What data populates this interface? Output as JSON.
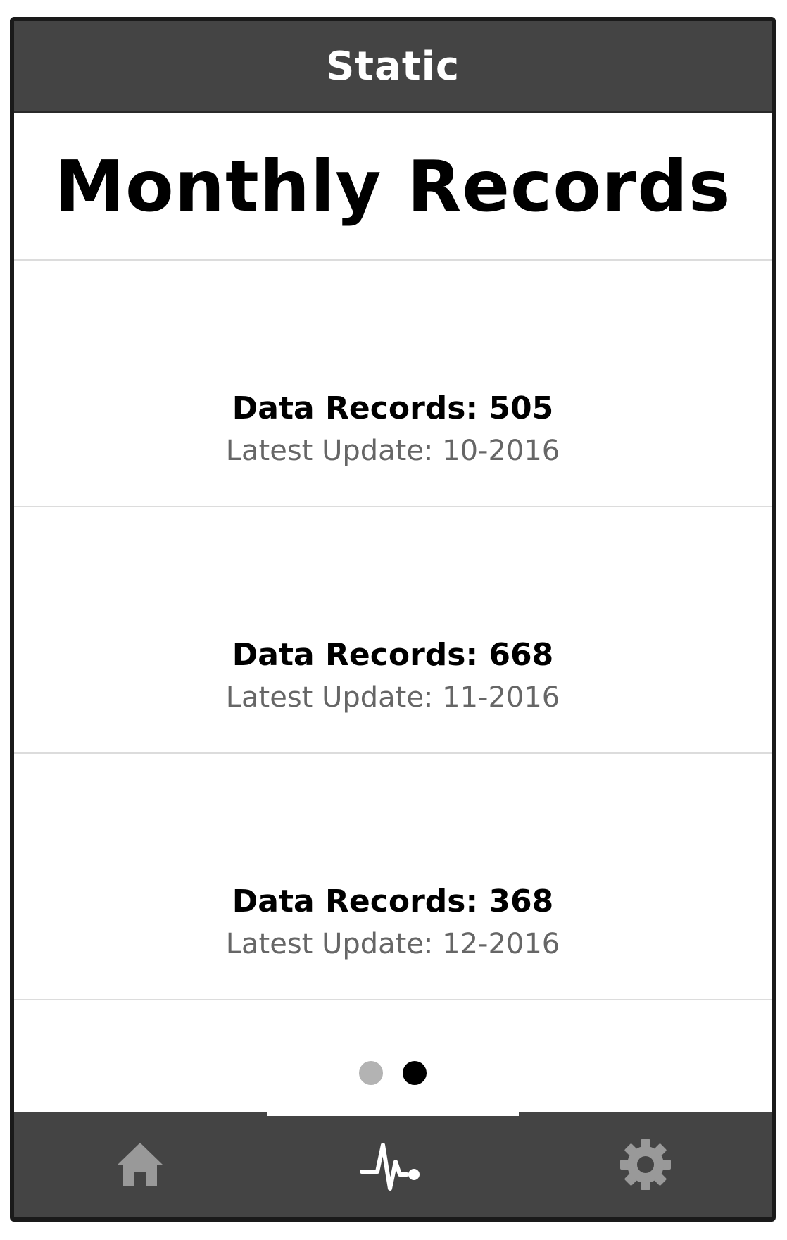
{
  "header": {
    "title": "Static"
  },
  "page": {
    "title": "Monthly Records"
  },
  "records": [
    {
      "count_label": "Data Records: 505",
      "update_label": "Latest Update: 10-2016"
    },
    {
      "count_label": "Data Records: 668",
      "update_label": "Latest Update: 11-2016"
    },
    {
      "count_label": "Data Records: 368",
      "update_label": "Latest Update: 12-2016"
    }
  ],
  "pager": {
    "total_pages": 2,
    "active_page": 2
  },
  "tabbar": {
    "tabs": [
      {
        "icon": "home-icon",
        "active": false
      },
      {
        "icon": "activity-icon",
        "active": true
      },
      {
        "icon": "gear-icon",
        "active": false
      }
    ]
  },
  "colors": {
    "bar_background": "#444444",
    "inactive_icon": "#999999",
    "active_icon": "#ffffff",
    "secondary_text": "#666666",
    "divider": "#dcdcdc"
  }
}
